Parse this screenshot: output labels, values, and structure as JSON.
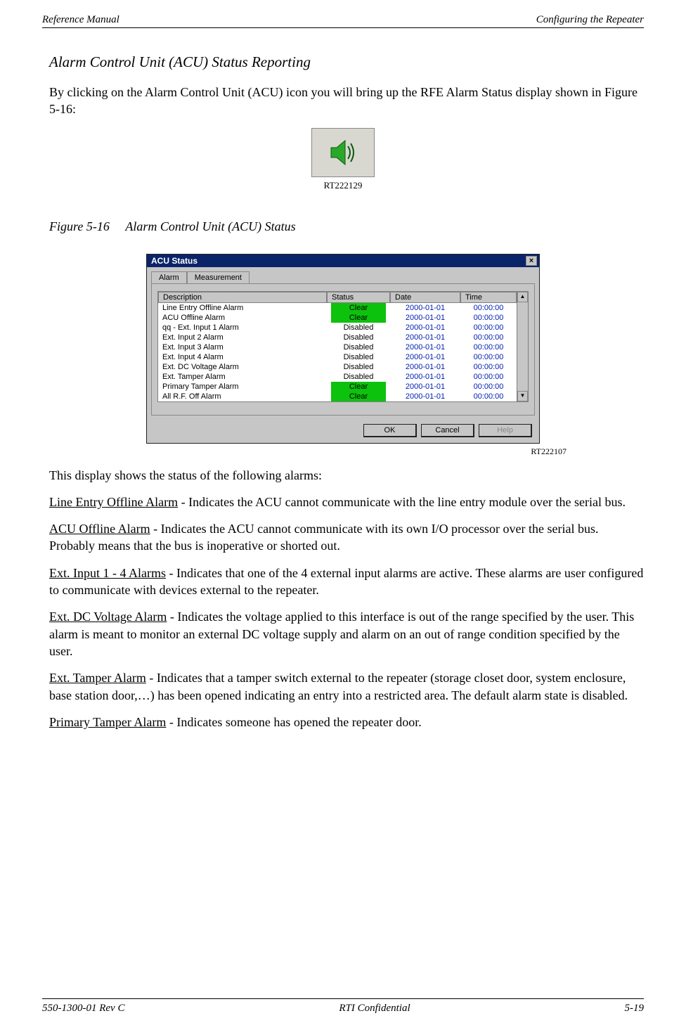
{
  "header": {
    "left": "Reference Manual",
    "right": "Configuring the Repeater"
  },
  "footer": {
    "left": "550-1300-01 Rev C",
    "center": "RTI Confidential",
    "right": "5-19"
  },
  "section": {
    "title": "Alarm Control Unit (ACU) Status Reporting",
    "intro": "By clicking on the Alarm Control Unit (ACU) icon you will bring up the RFE Alarm Status display shown in Figure 5-16:",
    "icon_id": "RT222129",
    "figure_label": "Figure 5-16",
    "figure_title": "Alarm Control Unit (ACU) Status",
    "dialog_img_id": "RT222107",
    "after_dialog": "This display shows the status of the following alarms:",
    "items": [
      {
        "name": "Line Entry Offline Alarm",
        "desc": " - Indicates the ACU cannot communicate with the line entry module over the serial bus."
      },
      {
        "name": "ACU Offline Alarm",
        "desc": " - Indicates the ACU cannot communicate with its own I/O processor over the serial bus. Probably means that the bus is inoperative or shorted out."
      },
      {
        "name": "Ext. Input 1 - 4 Alarms",
        "desc": " - Indicates that one of the 4 external input alarms are active. These alarms are user configured to communicate with devices external to the repeater."
      },
      {
        "name": "Ext. DC Voltage Alarm",
        "desc": " - Indicates the voltage applied to this interface is out of the range specified by the user. This alarm is meant to monitor an external DC voltage supply and alarm on an out of range condition specified by the user."
      },
      {
        "name": "Ext. Tamper Alarm",
        "desc": " - Indicates that a tamper switch external to the repeater (storage closet door, system enclosure, base station door,…) has been opened indicating an entry into a restricted area. The default alarm state is disabled."
      },
      {
        "name": "Primary Tamper Alarm",
        "desc": " - Indicates someone has opened the repeater door."
      }
    ]
  },
  "dialog": {
    "title": "ACU Status",
    "close": "×",
    "tabs": [
      "Alarm",
      "Measurement"
    ],
    "columns": [
      "Description",
      "Status",
      "Date",
      "Time"
    ],
    "rows": [
      {
        "desc": "Line Entry Offline Alarm",
        "status": "Clear",
        "clear": true,
        "date": "2000-01-01",
        "time": "00:00:00"
      },
      {
        "desc": "ACU Offline Alarm",
        "status": "Clear",
        "clear": true,
        "date": "2000-01-01",
        "time": "00:00:00"
      },
      {
        "desc": "qq - Ext. Input 1 Alarm",
        "status": "Disabled",
        "clear": false,
        "date": "2000-01-01",
        "time": "00:00:00"
      },
      {
        "desc": "Ext. Input 2 Alarm",
        "status": "Disabled",
        "clear": false,
        "date": "2000-01-01",
        "time": "00:00:00"
      },
      {
        "desc": "Ext. Input 3 Alarm",
        "status": "Disabled",
        "clear": false,
        "date": "2000-01-01",
        "time": "00:00:00"
      },
      {
        "desc": "Ext. Input 4 Alarm",
        "status": "Disabled",
        "clear": false,
        "date": "2000-01-01",
        "time": "00:00:00"
      },
      {
        "desc": "Ext. DC Voltage Alarm",
        "status": "Disabled",
        "clear": false,
        "date": "2000-01-01",
        "time": "00:00:00"
      },
      {
        "desc": "Ext. Tamper Alarm",
        "status": "Disabled",
        "clear": false,
        "date": "2000-01-01",
        "time": "00:00:00"
      },
      {
        "desc": "Primary Tamper Alarm",
        "status": "Clear",
        "clear": true,
        "date": "2000-01-01",
        "time": "00:00:00"
      },
      {
        "desc": "All R.F. Off Alarm",
        "status": "Clear",
        "clear": true,
        "date": "2000-01-01",
        "time": "00:00:00"
      }
    ],
    "buttons": {
      "ok": "OK",
      "cancel": "Cancel",
      "help": "Help"
    }
  }
}
